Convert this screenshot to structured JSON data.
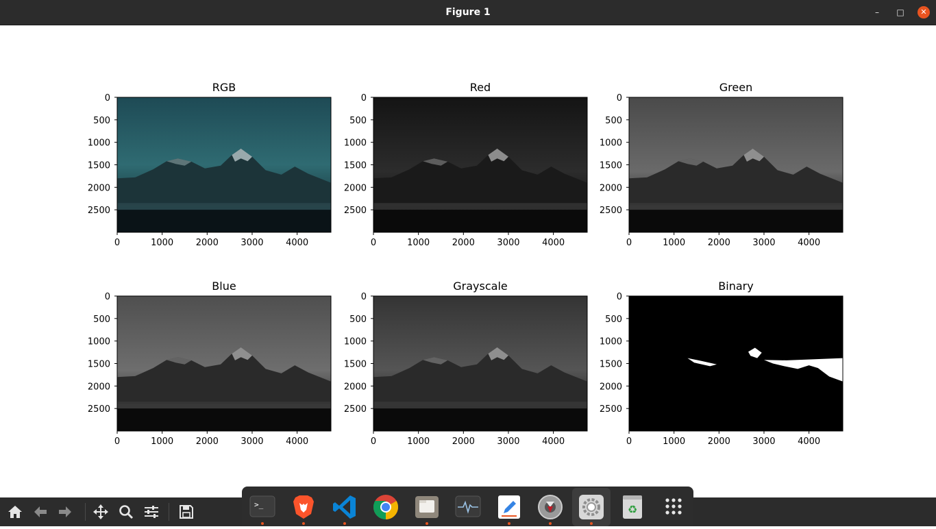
{
  "window": {
    "title": "Figure 1"
  },
  "toolbar": {
    "buttons": [
      {
        "name": "home-button",
        "icon": "home-icon"
      },
      {
        "name": "back-button",
        "icon": "arrow-left-icon"
      },
      {
        "name": "forward-button",
        "icon": "arrow-right-icon"
      },
      {
        "name": "pan-button",
        "icon": "move-icon"
      },
      {
        "name": "zoom-button",
        "icon": "magnifier-icon"
      },
      {
        "name": "configure-subplots-button",
        "icon": "sliders-icon"
      },
      {
        "name": "save-button",
        "icon": "floppy-icon"
      }
    ]
  },
  "dock": {
    "apps": [
      {
        "name": "terminal",
        "icon": "terminal-icon",
        "running": true
      },
      {
        "name": "brave",
        "icon": "brave-lion-icon",
        "running": true
      },
      {
        "name": "vscode",
        "icon": "vscode-icon",
        "running": true
      },
      {
        "name": "chrome",
        "icon": "chrome-icon",
        "running": false
      },
      {
        "name": "files",
        "icon": "folder-icon",
        "running": true
      },
      {
        "name": "system-monitor",
        "icon": "pulse-icon",
        "running": false
      },
      {
        "name": "text-editor",
        "icon": "pencil-icon",
        "running": true
      },
      {
        "name": "software-updater",
        "icon": "lifebuoy-icon",
        "running": true
      },
      {
        "name": "settings",
        "icon": "gear-icon",
        "running": true,
        "active": true
      },
      {
        "name": "trash",
        "icon": "recycle-icon",
        "running": false
      },
      {
        "name": "show-applications",
        "icon": "app-grid-icon",
        "running": false
      }
    ]
  },
  "chart_data": [
    {
      "type": "image",
      "title": "RGB",
      "xticks": [
        0,
        1000,
        2000,
        3000,
        4000
      ],
      "yticks": [
        0,
        500,
        1000,
        1500,
        2000,
        2500
      ],
      "xlim": [
        0,
        4752
      ],
      "ylim": [
        3000,
        0
      ],
      "colormap": "color"
    },
    {
      "type": "image",
      "title": "Red",
      "xticks": [
        0,
        1000,
        2000,
        3000,
        4000
      ],
      "yticks": [
        0,
        500,
        1000,
        1500,
        2000,
        2500
      ],
      "xlim": [
        0,
        4752
      ],
      "ylim": [
        3000,
        0
      ],
      "colormap": "gray"
    },
    {
      "type": "image",
      "title": "Green",
      "xticks": [
        0,
        1000,
        2000,
        3000,
        4000
      ],
      "yticks": [
        0,
        500,
        1000,
        1500,
        2000,
        2500
      ],
      "xlim": [
        0,
        4752
      ],
      "ylim": [
        3000,
        0
      ],
      "colormap": "gray"
    },
    {
      "type": "image",
      "title": "Blue",
      "xticks": [
        0,
        1000,
        2000,
        3000,
        4000
      ],
      "yticks": [
        0,
        500,
        1000,
        1500,
        2000,
        2500
      ],
      "xlim": [
        0,
        4752
      ],
      "ylim": [
        3000,
        0
      ],
      "colormap": "gray"
    },
    {
      "type": "image",
      "title": "Grayscale",
      "xticks": [
        0,
        1000,
        2000,
        3000,
        4000
      ],
      "yticks": [
        0,
        500,
        1000,
        1500,
        2000,
        2500
      ],
      "xlim": [
        0,
        4752
      ],
      "ylim": [
        3000,
        0
      ],
      "colormap": "gray"
    },
    {
      "type": "image",
      "title": "Binary",
      "xticks": [
        0,
        1000,
        2000,
        3000,
        4000
      ],
      "yticks": [
        0,
        500,
        1000,
        1500,
        2000,
        2500
      ],
      "xlim": [
        0,
        4752
      ],
      "ylim": [
        3000,
        0
      ],
      "colormap": "binary"
    }
  ]
}
